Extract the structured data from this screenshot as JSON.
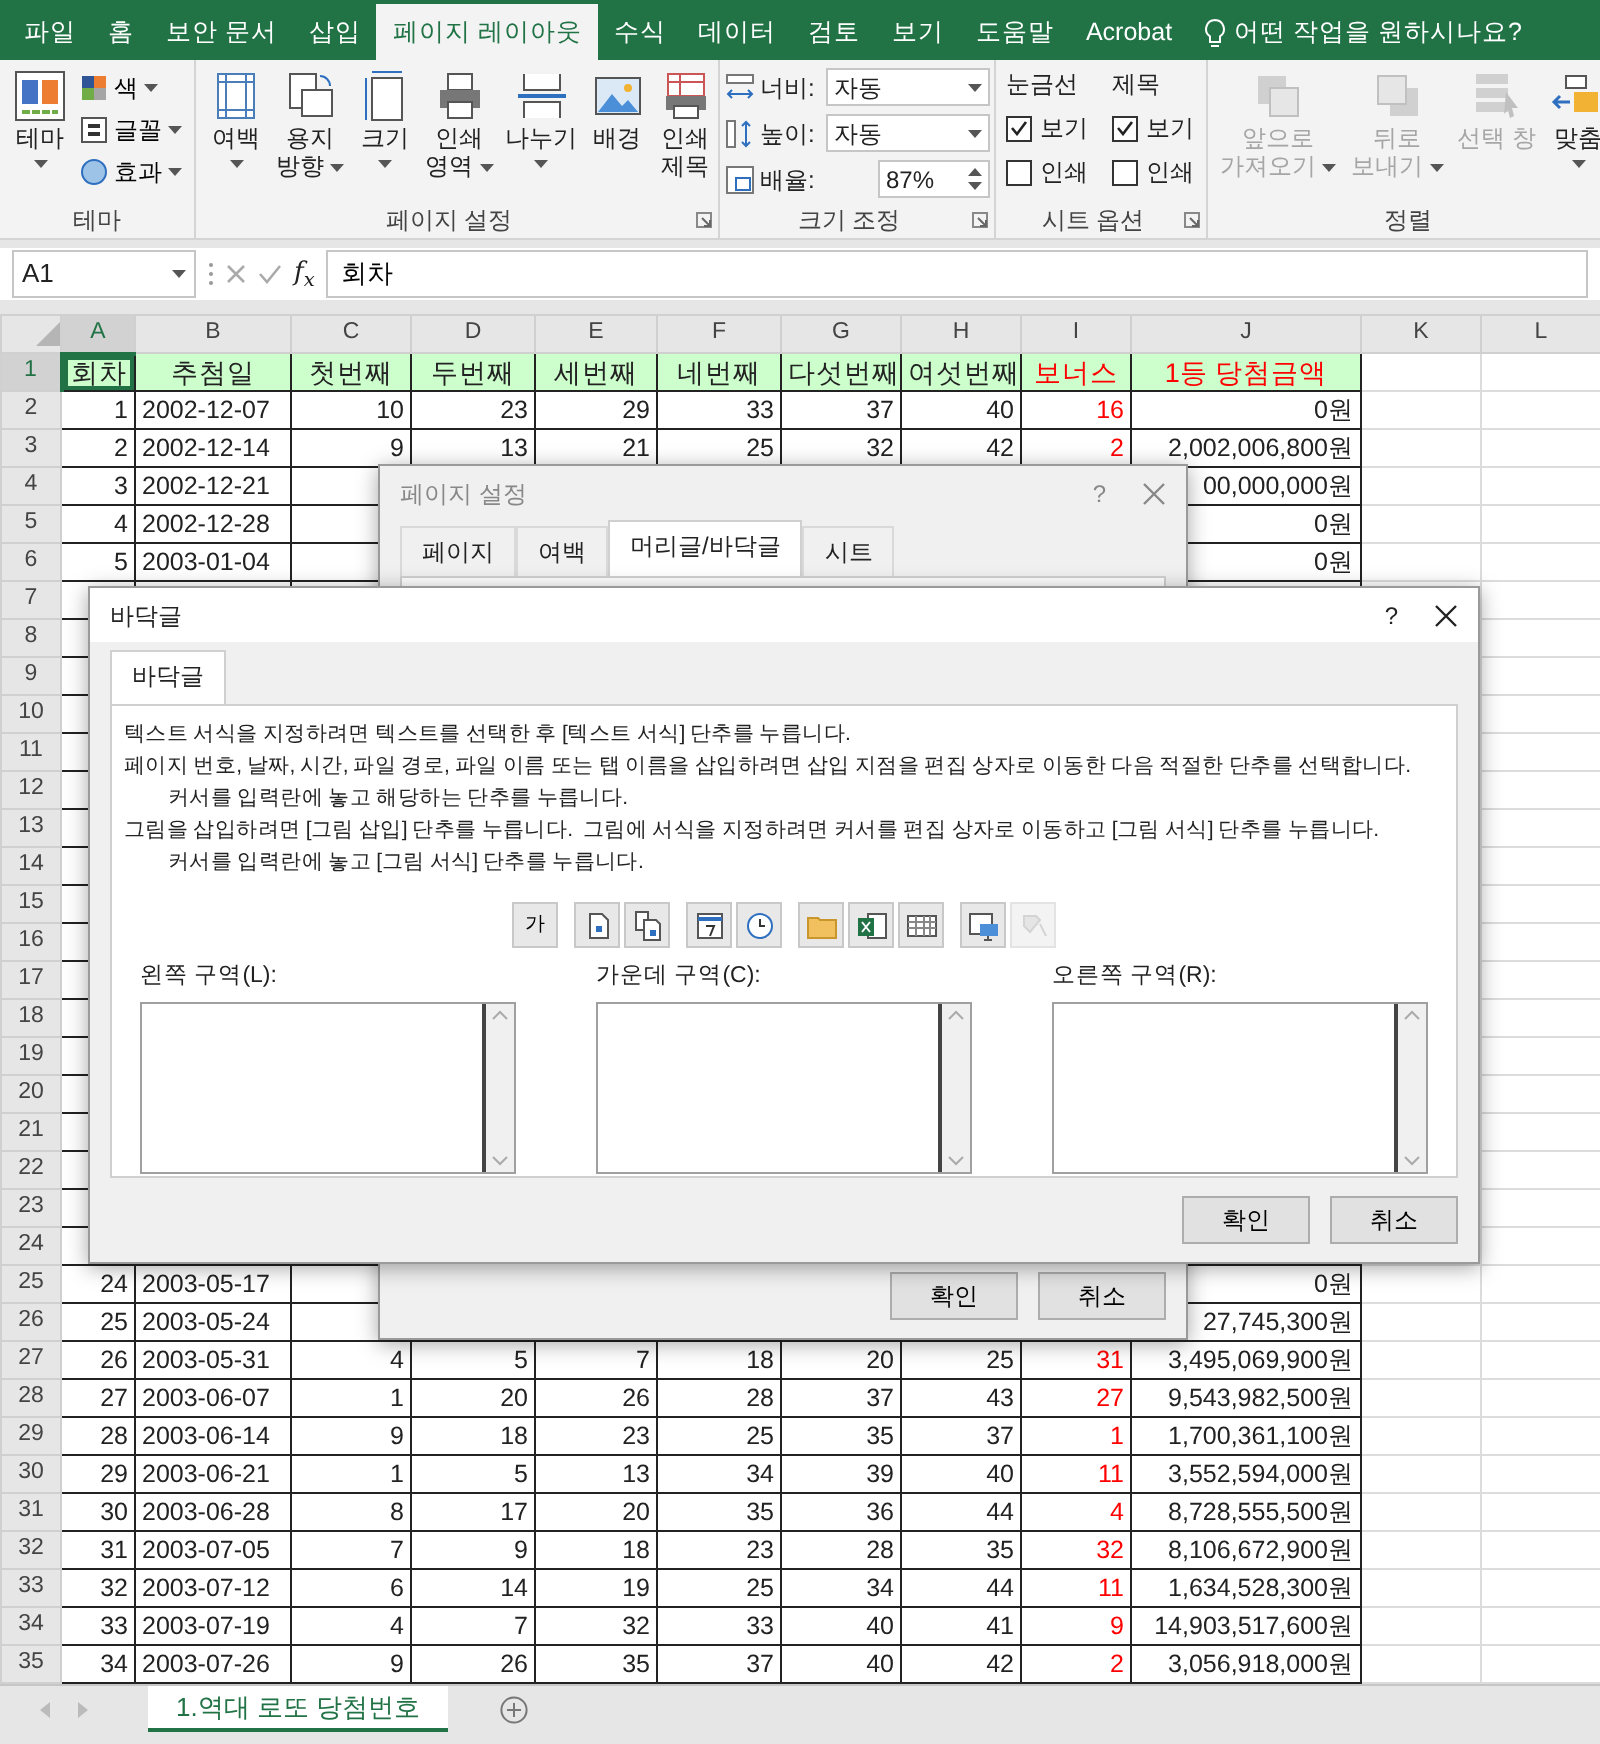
{
  "ribbon": {
    "tabs": [
      {
        "label": "파일",
        "selected": false
      },
      {
        "label": "홈",
        "selected": false
      },
      {
        "label": "보안 문서",
        "selected": false
      },
      {
        "label": "삽입",
        "selected": false
      },
      {
        "label": "페이지 레이아웃",
        "selected": true
      },
      {
        "label": "수식",
        "selected": false
      },
      {
        "label": "데이터",
        "selected": false
      },
      {
        "label": "검토",
        "selected": false
      },
      {
        "label": "보기",
        "selected": false
      },
      {
        "label": "도움말",
        "selected": false
      },
      {
        "label": "Acrobat",
        "selected": false
      }
    ],
    "search": "어떤 작업을 원하시나요?",
    "theme_group": {
      "label": "테마",
      "main": {
        "lines": [
          "테마"
        ],
        "dropdown": true
      },
      "items": [
        {
          "label": "색",
          "dropdown": true
        },
        {
          "label": "글꼴",
          "dropdown": true
        },
        {
          "label": "효과",
          "dropdown": true
        }
      ]
    },
    "page_setup_group": {
      "label": "페이지 설정",
      "launcher": true,
      "buttons": [
        {
          "lines": [
            "여백"
          ],
          "dropdown": true
        },
        {
          "lines": [
            "용지",
            "방향"
          ],
          "dropdown": true
        },
        {
          "lines": [
            "크기"
          ],
          "dropdown": true
        },
        {
          "lines": [
            "인쇄",
            "영역"
          ],
          "dropdown": true
        },
        {
          "lines": [
            "나누기"
          ],
          "dropdown": true
        },
        {
          "lines": [
            "배경"
          ],
          "dropdown": false
        },
        {
          "lines": [
            "인쇄",
            "제목"
          ],
          "dropdown": false
        }
      ]
    },
    "scale_group": {
      "label": "크기 조정",
      "launcher": true,
      "fields": [
        {
          "kind": "select",
          "label": "너비:",
          "value": "자동"
        },
        {
          "kind": "select",
          "label": "높이:",
          "value": "자동"
        },
        {
          "kind": "spin",
          "label": "배율:",
          "value": "87%"
        }
      ]
    },
    "sheet_options_group": {
      "label": "시트 옵션",
      "launcher": true,
      "columns": [
        {
          "title": "눈금선",
          "options": [
            {
              "label": "보기",
              "checked": true
            },
            {
              "label": "인쇄",
              "checked": false
            }
          ]
        },
        {
          "title": "제목",
          "options": [
            {
              "label": "보기",
              "checked": true
            },
            {
              "label": "인쇄",
              "checked": false
            }
          ]
        }
      ]
    },
    "arrange_group": {
      "label": "정렬",
      "launcher": false,
      "buttons": [
        {
          "lines": [
            "앞으로",
            "가져오기"
          ],
          "dropdown": true,
          "disabled": true
        },
        {
          "lines": [
            "뒤로",
            "보내기"
          ],
          "dropdown": true,
          "disabled": true
        },
        {
          "lines": [
            "선택 창"
          ],
          "dropdown": false,
          "disabled": true
        },
        {
          "lines": [
            "맞춤"
          ],
          "dropdown": true,
          "disabled": false
        }
      ]
    }
  },
  "formula_bar": {
    "name_box": "A1",
    "function_label": "f$_{x}$",
    "formula": "회차"
  },
  "sheet": {
    "columns": [
      {
        "label": "A",
        "selected": true
      },
      {
        "label": "B",
        "selected": false
      },
      {
        "label": "C",
        "selected": false
      },
      {
        "label": "D",
        "selected": false
      },
      {
        "label": "E",
        "selected": false
      },
      {
        "label": "F",
        "selected": false
      },
      {
        "label": "G",
        "selected": false
      },
      {
        "label": "H",
        "selected": false
      },
      {
        "label": "I",
        "selected": false
      },
      {
        "label": "J",
        "selected": false
      },
      {
        "label": "K",
        "selected": false
      },
      {
        "label": "L",
        "selected": false
      }
    ],
    "rows": [
      {
        "number": "1",
        "selected": true,
        "kind": "header",
        "cells": [
          "회차",
          "추첨일",
          "첫번째",
          "두번째",
          "세번째",
          "네번째",
          "다섯번째",
          "여섯번째",
          "보너스"
        ],
        "amount": "1등 당첨금액"
      },
      {
        "number": "2",
        "selected": false,
        "kind": "data",
        "cells": [
          "1",
          "2002-12-07",
          "10",
          "23",
          "29",
          "33",
          "37",
          "40",
          "16"
        ],
        "amount": "0원"
      },
      {
        "number": "3",
        "selected": false,
        "kind": "data",
        "cells": [
          "2",
          "2002-12-14",
          "9",
          "13",
          "21",
          "25",
          "32",
          "42",
          "2"
        ],
        "amount": "2,002,006,800원"
      },
      {
        "number": "4",
        "selected": false,
        "kind": "data",
        "cells": [
          "3",
          "2002-12-21"
        ],
        "amount": "00,000,000원"
      },
      {
        "number": "5",
        "selected": false,
        "kind": "data",
        "cells": [
          "4",
          "2002-12-28"
        ],
        "amount": "0원"
      },
      {
        "number": "6",
        "selected": false,
        "kind": "data",
        "cells": [
          "5",
          "2003-01-04"
        ],
        "amount": "0원"
      },
      {
        "number": "7",
        "selected": false,
        "kind": "data"
      },
      {
        "number": "8",
        "selected": false,
        "kind": "data"
      },
      {
        "number": "9",
        "selected": false,
        "kind": "data"
      },
      {
        "number": "10",
        "selected": false,
        "kind": "data"
      },
      {
        "number": "11",
        "selected": false,
        "kind": "data"
      },
      {
        "number": "12",
        "selected": false,
        "kind": "data"
      },
      {
        "number": "13",
        "selected": false,
        "kind": "data"
      },
      {
        "number": "14",
        "selected": false,
        "kind": "data"
      },
      {
        "number": "15",
        "selected": false,
        "kind": "data"
      },
      {
        "number": "16",
        "selected": false,
        "kind": "data"
      },
      {
        "number": "17",
        "selected": false,
        "kind": "data"
      },
      {
        "number": "18",
        "selected": false,
        "kind": "data"
      },
      {
        "number": "19",
        "selected": false,
        "kind": "data"
      },
      {
        "number": "20",
        "selected": false,
        "kind": "data"
      },
      {
        "number": "21",
        "selected": false,
        "kind": "data"
      },
      {
        "number": "22",
        "selected": false,
        "kind": "data"
      },
      {
        "number": "23",
        "selected": false,
        "kind": "data"
      },
      {
        "number": "24",
        "selected": false,
        "kind": "data"
      },
      {
        "number": "25",
        "selected": false,
        "kind": "data",
        "cells": [
          "24",
          "2003-05-17"
        ],
        "amount": "0원"
      },
      {
        "number": "26",
        "selected": false,
        "kind": "data",
        "cells": [
          "25",
          "2003-05-24"
        ],
        "amount": "27,745,300원"
      },
      {
        "number": "27",
        "selected": false,
        "kind": "data",
        "cells": [
          "26",
          "2003-05-31",
          "4",
          "5",
          "7",
          "18",
          "20",
          "25",
          "31"
        ],
        "amount": "3,495,069,900원"
      },
      {
        "number": "28",
        "selected": false,
        "kind": "data",
        "cells": [
          "27",
          "2003-06-07",
          "1",
          "20",
          "26",
          "28",
          "37",
          "43",
          "27"
        ],
        "amount": "9,543,982,500원"
      },
      {
        "number": "29",
        "selected": false,
        "kind": "data",
        "cells": [
          "28",
          "2003-06-14",
          "9",
          "18",
          "23",
          "25",
          "35",
          "37",
          "1"
        ],
        "amount": "1,700,361,100원"
      },
      {
        "number": "30",
        "selected": false,
        "kind": "data",
        "cells": [
          "29",
          "2003-06-21",
          "1",
          "5",
          "13",
          "34",
          "39",
          "40",
          "11"
        ],
        "amount": "3,552,594,000원"
      },
      {
        "number": "31",
        "selected": false,
        "kind": "data",
        "cells": [
          "30",
          "2003-06-28",
          "8",
          "17",
          "20",
          "35",
          "36",
          "44",
          "4"
        ],
        "amount": "8,728,555,500원"
      },
      {
        "number": "32",
        "selected": false,
        "kind": "data",
        "cells": [
          "31",
          "2003-07-05",
          "7",
          "9",
          "18",
          "23",
          "28",
          "35",
          "32"
        ],
        "amount": "8,106,672,900원"
      },
      {
        "number": "33",
        "selected": false,
        "kind": "data",
        "cells": [
          "32",
          "2003-07-12",
          "6",
          "14",
          "19",
          "25",
          "34",
          "44",
          "11"
        ],
        "amount": "1,634,528,300원"
      },
      {
        "number": "34",
        "selected": false,
        "kind": "data",
        "cells": [
          "33",
          "2003-07-19",
          "4",
          "7",
          "32",
          "33",
          "40",
          "41",
          "9"
        ],
        "amount": "14,903,517,600원"
      },
      {
        "number": "35",
        "selected": false,
        "kind": "data",
        "cells": [
          "34",
          "2003-07-26",
          "9",
          "26",
          "35",
          "37",
          "40",
          "42",
          "2"
        ],
        "amount": "3,056,918,000원"
      }
    ]
  },
  "page_setup_dialog": {
    "title": "페이지 설정",
    "help": "?",
    "tabs": [
      {
        "label": "페이지",
        "selected": false
      },
      {
        "label": "여백",
        "selected": false
      },
      {
        "label": "머리글/바닥글",
        "selected": true
      },
      {
        "label": "시트",
        "selected": false
      }
    ],
    "buttons": [
      "확인",
      "취소"
    ]
  },
  "footer_dialog": {
    "title": "바닥글",
    "help": "?",
    "tabs": [
      {
        "label": "바닥글",
        "selected": true
      }
    ],
    "instructions": [
      {
        "text": "텍스트 서식을 지정하려면 텍스트를 선택한 후 [텍스트 서식] 단추를 누릅니다."
      },
      {
        "text": "페이지 번호, 날짜, 시간, 파일 경로, 파일 이름 또는 탭 이름을 삽입하려면 삽입 지점을 편집 상자로 이동한 다음 적절한 단추를 선택합니다.",
        "children": [
          {
            "text": "커서를 입력란에 놓고 해당하는 단추를 누릅니다."
          }
        ]
      },
      {
        "text": "그림을 삽입하려면 [그림 삽입] 단추를 누릅니다.  그림에 서식을 지정하려면 커서를 편집 상자로 이동하고 [그림 서식] 단추를 누릅니다.",
        "children": [
          {
            "text": "커서를 입력란에 놓고 [그림 서식] 단추를 누릅니다."
          }
        ]
      }
    ],
    "toolbar": [
      [
        {
          "kind": "text",
          "label": "가",
          "disabled": false
        }
      ],
      [
        {
          "kind": "page",
          "disabled": false
        },
        {
          "kind": "pages",
          "disabled": false
        }
      ],
      [
        {
          "kind": "calendar",
          "disabled": false
        },
        {
          "kind": "clock",
          "disabled": false
        }
      ],
      [
        {
          "kind": "folder",
          "disabled": false
        },
        {
          "kind": "workbook",
          "disabled": false
        },
        {
          "kind": "sheet",
          "disabled": false
        }
      ],
      [
        {
          "kind": "picture",
          "disabled": false
        },
        {
          "kind": "format",
          "disabled": true
        }
      ]
    ],
    "sections": [
      "왼쪽 구역(L):",
      "가운데 구역(C):",
      "오른쪽 구역(R):"
    ],
    "buttons": [
      "확인",
      "취소"
    ]
  },
  "sheet_tabs": [
    {
      "label": "1.역대 로또 당첨번호",
      "selected": true
    }
  ]
}
